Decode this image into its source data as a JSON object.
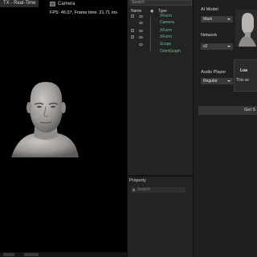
{
  "viewport": {
    "tab_label": "TX - Real-Time",
    "camera_label": "Camera",
    "fps_text": "FPS: 46.07, Frame time: 21.71 ms"
  },
  "outliner": {
    "search_placeholder": "Search",
    "col_name": "Name",
    "col_type": "Type",
    "rows": [
      {
        "label": "XForm"
      },
      {
        "label": "Camera"
      },
      {
        "label": "XForm"
      },
      {
        "label": "XForm"
      },
      {
        "label": "Scope"
      },
      {
        "label": "OmniGraph"
      }
    ]
  },
  "property": {
    "tab_label": "Property",
    "search_placeholder": "Search"
  },
  "right_panel": {
    "ai_model_label": "AI Model",
    "ai_model_value": "Mark",
    "network_label": "Network",
    "network_value": "v2",
    "audio_player_label": "Audio Player",
    "audio_player_value": "Regular",
    "load_title": "Loa",
    "load_text": "This wi",
    "get_button_label": "Get S"
  }
}
